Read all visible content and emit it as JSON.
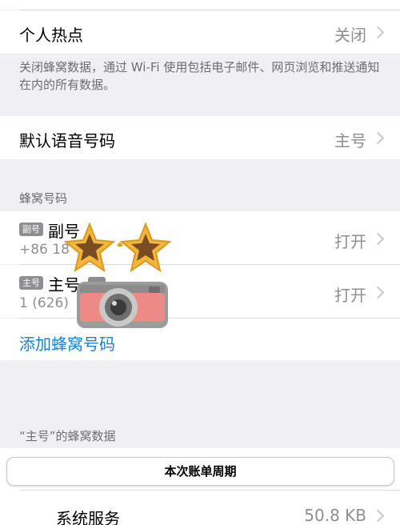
{
  "hotspot": {
    "label": "个人热点",
    "value": "关闭"
  },
  "cellular_note": "关闭蜂窝数据，通过 Wi-Fi 使用包括电子邮件、网页浏览和推送通知在内的所有数据。",
  "default_voice": {
    "label": "默认语音号码",
    "value": "主号"
  },
  "cellular_numbers": {
    "header": "蜂窝号码",
    "lines": [
      {
        "badge": "副号",
        "name": "副号",
        "number": "+86 18",
        "status": "打开"
      },
      {
        "badge": "主号",
        "name": "主号",
        "number": "1 (626)",
        "status": "打开"
      }
    ],
    "add_link": "添加蜂窝号码"
  },
  "main_data_header": "“主号”的蜂窝数据",
  "billing_cycle_button": "本次账单周期",
  "system_services": {
    "label": "系统服务",
    "value": "50.8 KB"
  }
}
